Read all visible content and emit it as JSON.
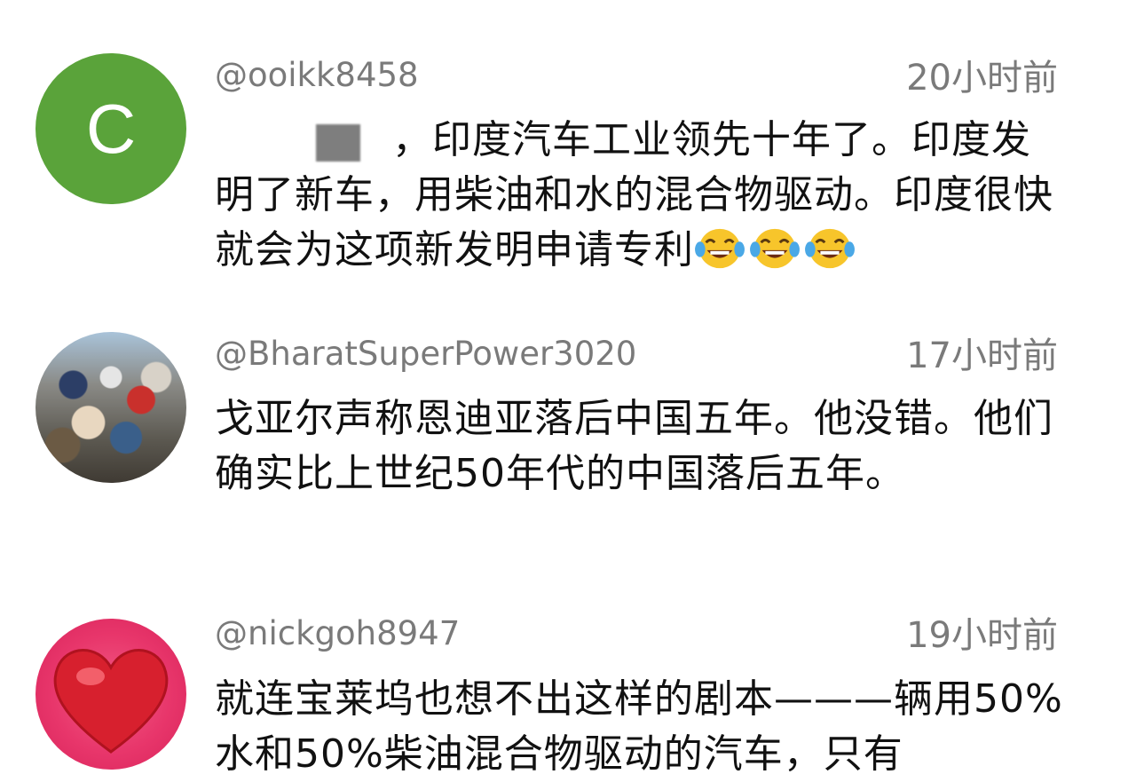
{
  "comments": [
    {
      "avatar_letter": "C",
      "avatar_color": "#5aa33a",
      "username": "@ooikk8458",
      "time": "20小时前",
      "text": "，印度汽车工业领先十年了。印度发明了新车，用柴油和水的混合物驱动。印度很快就会为这项新发明申请专利",
      "emoji": [
        "laughing-tears-icon",
        "laughing-tears-icon",
        "laughing-tears-icon"
      ]
    },
    {
      "avatar": "crowd-photo",
      "username": "@BharatSuperPower3020",
      "time": "17小时前",
      "text": "戈亚尔声称恩迪亚落后中国五年。他没错。他们确实比上世纪50年代的中国落后五年。"
    },
    {
      "avatar": "red-heart-photo",
      "avatar_color": "#e8366b",
      "username": "@nickgoh8947",
      "time": "19小时前",
      "text": "就连宝莱坞也想不出这样的剧本———辆用50%水和50%柴油混合物驱动的汽车，只有"
    }
  ]
}
